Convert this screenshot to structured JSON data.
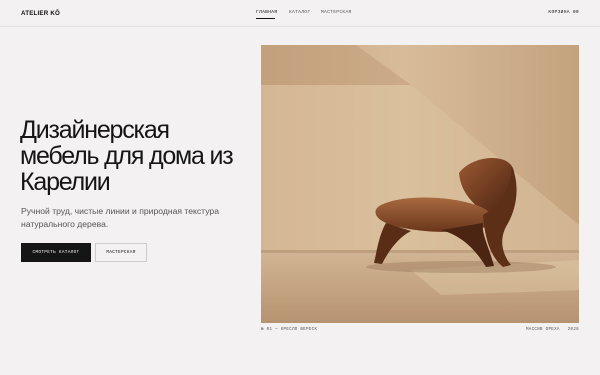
{
  "header": {
    "logo": "ATELIER KŌ",
    "nav": [
      {
        "label": "ГЛАВНАЯ",
        "active": true
      },
      {
        "label": "КАТАЛОГ",
        "active": false
      },
      {
        "label": "МАСТЕРСКАЯ",
        "active": false
      }
    ],
    "cart_label": "КОРЗИНА 00"
  },
  "hero": {
    "title": "Дизайнерская мебель для дома из Карелии",
    "subtitle": "Ручной труд, чистые линии и природная текстура натурального дерева.",
    "primary_button": "СМОТРЕТЬ КАТАЛОГ",
    "secondary_button": "МАСТЕРСКАЯ"
  },
  "image_caption": {
    "left": "№ 01 — КРЕСЛО ВЕРЕСК",
    "right_material": "МАССИВ ОРЕХА",
    "right_year": "2026"
  },
  "colors": {
    "background": "#f3f1f2",
    "primary_button": "#151515",
    "wall": "#d9bb97",
    "wood": "#7a4526"
  }
}
